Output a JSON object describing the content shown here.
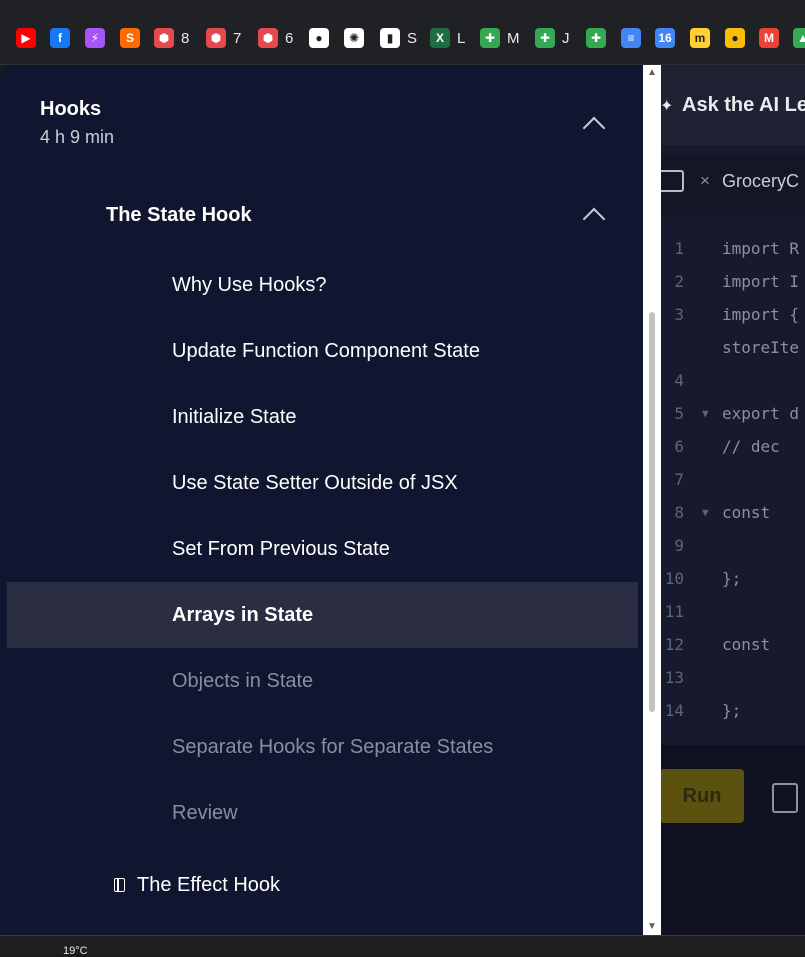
{
  "bookmarks": [
    {
      "icon": "youtube-icon",
      "label": "",
      "color": "#ff0000",
      "glyph": "▶"
    },
    {
      "icon": "facebook-icon",
      "label": "",
      "color": "#1877f2",
      "glyph": "f"
    },
    {
      "icon": "messenger-icon",
      "label": "",
      "color": "#a855f7",
      "glyph": "⚡"
    },
    {
      "icon": "swirl-icon",
      "label": "",
      "color": "#ff6b00",
      "glyph": "S"
    },
    {
      "icon": "hexagon-icon",
      "label": "8",
      "color": "#e5484d",
      "glyph": "⬢"
    },
    {
      "icon": "hexagon-icon",
      "label": "7",
      "color": "#e5484d",
      "glyph": "⬢"
    },
    {
      "icon": "hexagon-icon",
      "label": "6",
      "color": "#e5484d",
      "glyph": "⬢"
    },
    {
      "icon": "github-icon",
      "label": "",
      "color": "#ffffff",
      "glyph": "●"
    },
    {
      "icon": "openai-icon",
      "label": "",
      "color": "#ffffff",
      "glyph": "✺"
    },
    {
      "icon": "document-icon",
      "label": "S",
      "color": "#ffffff",
      "glyph": "▮"
    },
    {
      "icon": "excel-icon",
      "label": "L",
      "color": "#1d6f42",
      "glyph": "X"
    },
    {
      "icon": "sheets-icon",
      "label": "M",
      "color": "#34a853",
      "glyph": "✚"
    },
    {
      "icon": "sheets-icon",
      "label": "J",
      "color": "#34a853",
      "glyph": "✚"
    },
    {
      "icon": "sheets-icon",
      "label": "",
      "color": "#34a853",
      "glyph": "✚"
    },
    {
      "icon": "docs-icon",
      "label": "",
      "color": "#4285f4",
      "glyph": "≡"
    },
    {
      "icon": "calendar-icon",
      "label": "",
      "color": "#4285f4",
      "glyph": "16"
    },
    {
      "icon": "miro-icon",
      "label": "",
      "color": "#ffd02f",
      "glyph": "m"
    },
    {
      "icon": "keep-icon",
      "label": "",
      "color": "#fbbc04",
      "glyph": "●"
    },
    {
      "icon": "gmail-icon",
      "label": "",
      "color": "#ea4335",
      "glyph": "M"
    },
    {
      "icon": "drive-icon",
      "label": "",
      "color": "#34a853",
      "glyph": "▲"
    }
  ],
  "editor": {
    "ask_ai": "Ask the AI Le",
    "tab_name": "GroceryC",
    "lines": [
      {
        "n": "1",
        "text": "import R",
        "fold": false
      },
      {
        "n": "2",
        "text": "import I",
        "fold": false
      },
      {
        "n": "3",
        "text": "import {",
        "fold": false
      },
      {
        "n": "",
        "text": "storeIte",
        "fold": false
      },
      {
        "n": "4",
        "text": "",
        "fold": false
      },
      {
        "n": "5",
        "text": "export d",
        "fold": true
      },
      {
        "n": "6",
        "text": "  // dec",
        "fold": false
      },
      {
        "n": "7",
        "text": "",
        "fold": false
      },
      {
        "n": "8",
        "text": "  const",
        "fold": true
      },
      {
        "n": "9",
        "text": "",
        "fold": false
      },
      {
        "n": "10",
        "text": "   };",
        "fold": false
      },
      {
        "n": "11",
        "text": "",
        "fold": false
      },
      {
        "n": "12",
        "text": "  const",
        "fold": false
      },
      {
        "n": "13",
        "text": "",
        "fold": false
      },
      {
        "n": "14",
        "text": "  };",
        "fold": false
      }
    ],
    "run_label": "Run"
  },
  "nav": {
    "module_title": "Hooks",
    "module_duration": "4 h 9 min",
    "lesson_title": "The State Hook",
    "items": [
      {
        "label": "Why Use Hooks?",
        "state": "done"
      },
      {
        "label": "Update Function Component State",
        "state": "done"
      },
      {
        "label": "Initialize State",
        "state": "done"
      },
      {
        "label": "Use State Setter Outside of JSX",
        "state": "done"
      },
      {
        "label": "Set From Previous State",
        "state": "done"
      },
      {
        "label": "Arrays in State",
        "state": "active"
      },
      {
        "label": "Objects in State",
        "state": "locked"
      },
      {
        "label": "Separate Hooks for Separate States",
        "state": "locked"
      },
      {
        "label": "Review",
        "state": "locked"
      }
    ],
    "next_lesson": "The Effect Hook"
  },
  "taskbar": {
    "temperature": "19°C"
  }
}
